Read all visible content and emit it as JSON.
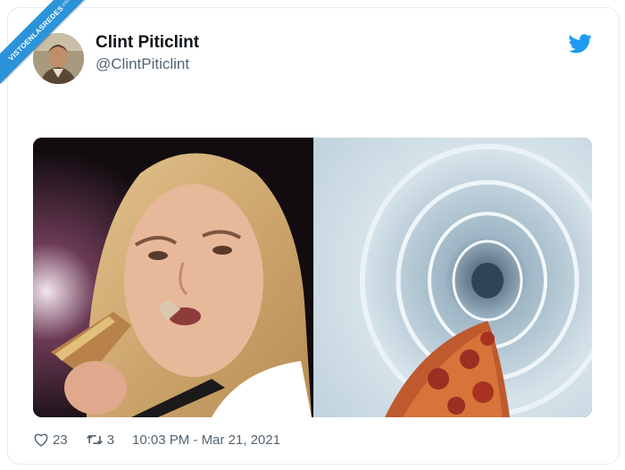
{
  "watermark": {
    "text": "VISTOENLASREDES",
    "suffix": ".com"
  },
  "author": {
    "name": "Clint Piticlint",
    "handle": "@ClintPiticlint"
  },
  "icons": {
    "brand": "twitter-bird-icon",
    "like": "heart-icon",
    "retweet": "retweet-icon"
  },
  "colors": {
    "brand": "#1d9bf0",
    "watermark": "#2b93d9",
    "meta": "#536471"
  },
  "footer": {
    "likes": "23",
    "retweets": "3",
    "timestamp": "10:03 PM - Mar 21, 2021"
  }
}
